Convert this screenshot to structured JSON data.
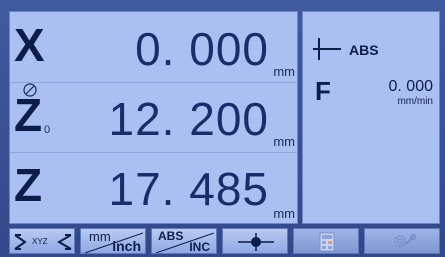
{
  "axes": [
    {
      "letter": "X",
      "value": "0. 000",
      "unit": "mm"
    },
    {
      "letter": "Z",
      "sub": "0",
      "value": "12. 200",
      "unit": "mm"
    },
    {
      "letter": "Z",
      "value": "17. 485",
      "unit": "mm"
    }
  ],
  "side": {
    "mode": "ABS",
    "feed_label": "F",
    "feed_value": "0. 000",
    "feed_unit": "mm/min"
  },
  "softkeys": {
    "xyz": "XYZ",
    "mm": "mm",
    "inch": "inch",
    "abs": "ABS",
    "inc": "INC"
  },
  "icons": {
    "zero_ref": "zero-reference-icon",
    "datum": "datum-crosshair-icon",
    "calculator": "calculator-icon",
    "settings": "gear-wrench-icon"
  },
  "colors": {
    "background": "#3a4f8c",
    "panel": "#aac0f2",
    "text": "#0d1d4a"
  }
}
